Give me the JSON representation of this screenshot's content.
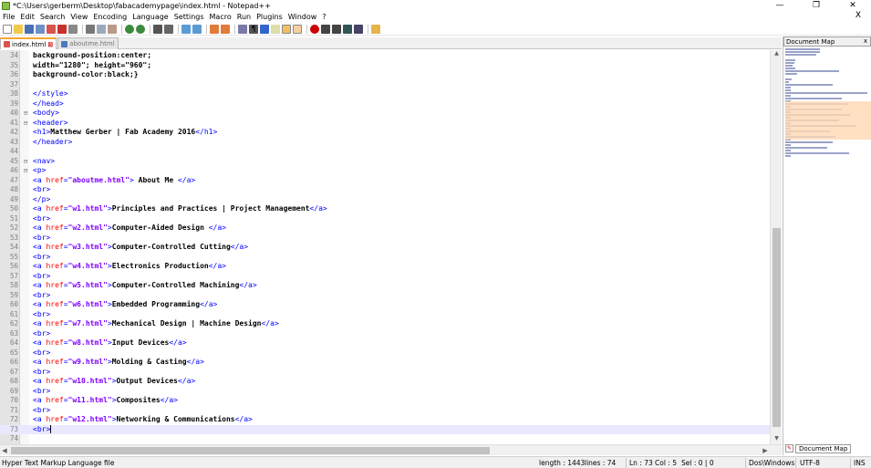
{
  "window": {
    "title": "*C:\\Users\\gerberm\\Desktop\\fabacademypage\\index.html - Notepad++",
    "minimize": "—",
    "maximize": "❐",
    "close": "✕"
  },
  "menu": [
    "File",
    "Edit",
    "Search",
    "View",
    "Encoding",
    "Language",
    "Settings",
    "Macro",
    "Run",
    "Plugins",
    "Window",
    "?"
  ],
  "menu_close_doc": "X",
  "tabs": [
    {
      "label": "index.html",
      "active": true,
      "modified": true
    },
    {
      "label": "aboutme.html",
      "active": false,
      "modified": false
    }
  ],
  "editor": {
    "lines": [
      {
        "n": "34",
        "fold": "",
        "segs": [
          {
            "c": "css",
            "t": "background-position:center;"
          }
        ]
      },
      {
        "n": "35",
        "fold": "",
        "segs": [
          {
            "c": "css",
            "t": "width=\"1280\"; height=\"960\";"
          }
        ]
      },
      {
        "n": "36",
        "fold": "",
        "segs": [
          {
            "c": "css",
            "t": "background-color:black;}"
          }
        ]
      },
      {
        "n": "37",
        "fold": "",
        "segs": []
      },
      {
        "n": "38",
        "fold": "",
        "segs": [
          {
            "c": "tag",
            "t": "</style>"
          }
        ]
      },
      {
        "n": "39",
        "fold": "",
        "segs": [
          {
            "c": "tag",
            "t": "</head>"
          }
        ]
      },
      {
        "n": "40",
        "fold": "⊟",
        "segs": [
          {
            "c": "tag",
            "t": "<body>"
          }
        ]
      },
      {
        "n": "41",
        "fold": "⊟",
        "segs": [
          {
            "c": "tag",
            "t": "<header>"
          }
        ]
      },
      {
        "n": "42",
        "fold": "",
        "segs": [
          {
            "c": "tag",
            "t": "<h1>"
          },
          {
            "c": "txt",
            "t": "Matthew Gerber | Fab Academy 2016"
          },
          {
            "c": "tag",
            "t": "</h1>"
          }
        ]
      },
      {
        "n": "43",
        "fold": "",
        "segs": [
          {
            "c": "tag",
            "t": "</header>"
          }
        ]
      },
      {
        "n": "44",
        "fold": "",
        "segs": []
      },
      {
        "n": "45",
        "fold": "⊟",
        "segs": [
          {
            "c": "tag",
            "t": "<nav>"
          }
        ]
      },
      {
        "n": "46",
        "fold": "⊟",
        "segs": [
          {
            "c": "tag",
            "t": "<p>"
          }
        ]
      },
      {
        "n": "47",
        "fold": "",
        "segs": [
          {
            "c": "tag",
            "t": "<a "
          },
          {
            "c": "attr",
            "t": "href"
          },
          {
            "c": "tag",
            "t": "="
          },
          {
            "c": "str",
            "t": "\"aboutme.html\""
          },
          {
            "c": "tag",
            "t": ">"
          },
          {
            "c": "txt",
            "t": " About Me "
          },
          {
            "c": "tag",
            "t": "</a>"
          }
        ]
      },
      {
        "n": "48",
        "fold": "",
        "segs": [
          {
            "c": "tag",
            "t": "<br>"
          }
        ]
      },
      {
        "n": "49",
        "fold": "",
        "segs": [
          {
            "c": "tag",
            "t": "</p>"
          }
        ]
      },
      {
        "n": "50",
        "fold": "",
        "segs": [
          {
            "c": "tag",
            "t": "<a "
          },
          {
            "c": "attr",
            "t": "href"
          },
          {
            "c": "tag",
            "t": "="
          },
          {
            "c": "str",
            "t": "\"w1.html\""
          },
          {
            "c": "tag",
            "t": ">"
          },
          {
            "c": "txt",
            "t": "Principles and Practices | Project Management"
          },
          {
            "c": "tag",
            "t": "</a>"
          }
        ]
      },
      {
        "n": "51",
        "fold": "",
        "segs": [
          {
            "c": "tag",
            "t": "<br>"
          }
        ]
      },
      {
        "n": "52",
        "fold": "",
        "segs": [
          {
            "c": "tag",
            "t": "<a "
          },
          {
            "c": "attr",
            "t": "href"
          },
          {
            "c": "tag",
            "t": "="
          },
          {
            "c": "str",
            "t": "\"w2.html\""
          },
          {
            "c": "tag",
            "t": ">"
          },
          {
            "c": "txt",
            "t": "Computer-Aided Design "
          },
          {
            "c": "tag",
            "t": "</a>"
          }
        ]
      },
      {
        "n": "53",
        "fold": "",
        "segs": [
          {
            "c": "tag",
            "t": "<br>"
          }
        ]
      },
      {
        "n": "54",
        "fold": "",
        "segs": [
          {
            "c": "tag",
            "t": "<a "
          },
          {
            "c": "attr",
            "t": "href"
          },
          {
            "c": "tag",
            "t": "="
          },
          {
            "c": "str",
            "t": "\"w3.html\""
          },
          {
            "c": "tag",
            "t": ">"
          },
          {
            "c": "txt",
            "t": "Computer-Controlled Cutting"
          },
          {
            "c": "tag",
            "t": "</a>"
          }
        ]
      },
      {
        "n": "55",
        "fold": "",
        "segs": [
          {
            "c": "tag",
            "t": "<br>"
          }
        ]
      },
      {
        "n": "56",
        "fold": "",
        "segs": [
          {
            "c": "tag",
            "t": "<a "
          },
          {
            "c": "attr",
            "t": "href"
          },
          {
            "c": "tag",
            "t": "="
          },
          {
            "c": "str",
            "t": "\"w4.html\""
          },
          {
            "c": "tag",
            "t": ">"
          },
          {
            "c": "txt",
            "t": "Electronics Production"
          },
          {
            "c": "tag",
            "t": "</a>"
          }
        ]
      },
      {
        "n": "57",
        "fold": "",
        "segs": [
          {
            "c": "tag",
            "t": "<br>"
          }
        ]
      },
      {
        "n": "58",
        "fold": "",
        "segs": [
          {
            "c": "tag",
            "t": "<a "
          },
          {
            "c": "attr",
            "t": "href"
          },
          {
            "c": "tag",
            "t": "="
          },
          {
            "c": "str",
            "t": "\"w5.html\""
          },
          {
            "c": "tag",
            "t": ">"
          },
          {
            "c": "txt",
            "t": "Computer-Controlled Machining"
          },
          {
            "c": "tag",
            "t": "</a>"
          }
        ]
      },
      {
        "n": "59",
        "fold": "",
        "segs": [
          {
            "c": "tag",
            "t": "<br>"
          }
        ]
      },
      {
        "n": "60",
        "fold": "",
        "segs": [
          {
            "c": "tag",
            "t": "<a "
          },
          {
            "c": "attr",
            "t": "href"
          },
          {
            "c": "tag",
            "t": "="
          },
          {
            "c": "str",
            "t": "\"w6.html\""
          },
          {
            "c": "tag",
            "t": ">"
          },
          {
            "c": "txt",
            "t": "Embedded Programming"
          },
          {
            "c": "tag",
            "t": "</a>"
          }
        ]
      },
      {
        "n": "61",
        "fold": "",
        "segs": [
          {
            "c": "tag",
            "t": "<br>"
          }
        ]
      },
      {
        "n": "62",
        "fold": "",
        "segs": [
          {
            "c": "tag",
            "t": "<a "
          },
          {
            "c": "attr",
            "t": "href"
          },
          {
            "c": "tag",
            "t": "="
          },
          {
            "c": "str",
            "t": "\"w7.html\""
          },
          {
            "c": "tag",
            "t": ">"
          },
          {
            "c": "txt",
            "t": "Mechanical Design | Machine Design"
          },
          {
            "c": "tag",
            "t": "</a>"
          }
        ]
      },
      {
        "n": "63",
        "fold": "",
        "segs": [
          {
            "c": "tag",
            "t": "<br>"
          }
        ]
      },
      {
        "n": "64",
        "fold": "",
        "segs": [
          {
            "c": "tag",
            "t": "<a "
          },
          {
            "c": "attr",
            "t": "href"
          },
          {
            "c": "tag",
            "t": "="
          },
          {
            "c": "str",
            "t": "\"w8.html\""
          },
          {
            "c": "tag",
            "t": ">"
          },
          {
            "c": "txt",
            "t": "Input Devices"
          },
          {
            "c": "tag",
            "t": "</a>"
          }
        ]
      },
      {
        "n": "65",
        "fold": "",
        "segs": [
          {
            "c": "tag",
            "t": "<br>"
          }
        ]
      },
      {
        "n": "66",
        "fold": "",
        "segs": [
          {
            "c": "tag",
            "t": "<a "
          },
          {
            "c": "attr",
            "t": "href"
          },
          {
            "c": "tag",
            "t": "="
          },
          {
            "c": "str",
            "t": "\"w9.html\""
          },
          {
            "c": "tag",
            "t": ">"
          },
          {
            "c": "txt",
            "t": "Molding & Casting"
          },
          {
            "c": "tag",
            "t": "</a>"
          }
        ]
      },
      {
        "n": "67",
        "fold": "",
        "segs": [
          {
            "c": "tag",
            "t": "<br>"
          }
        ]
      },
      {
        "n": "68",
        "fold": "",
        "segs": [
          {
            "c": "tag",
            "t": "<a "
          },
          {
            "c": "attr",
            "t": "href"
          },
          {
            "c": "tag",
            "t": "="
          },
          {
            "c": "str",
            "t": "\"w10.html\""
          },
          {
            "c": "tag",
            "t": ">"
          },
          {
            "c": "txt",
            "t": "Output Devices"
          },
          {
            "c": "tag",
            "t": "</a>"
          }
        ]
      },
      {
        "n": "69",
        "fold": "",
        "segs": [
          {
            "c": "tag",
            "t": "<br>"
          }
        ]
      },
      {
        "n": "70",
        "fold": "",
        "segs": [
          {
            "c": "tag",
            "t": "<a "
          },
          {
            "c": "attr",
            "t": "href"
          },
          {
            "c": "tag",
            "t": "="
          },
          {
            "c": "str",
            "t": "\"w11.html\""
          },
          {
            "c": "tag",
            "t": ">"
          },
          {
            "c": "txt",
            "t": "Composites"
          },
          {
            "c": "tag",
            "t": "</a>"
          }
        ]
      },
      {
        "n": "71",
        "fold": "",
        "segs": [
          {
            "c": "tag",
            "t": "<br>"
          }
        ]
      },
      {
        "n": "72",
        "fold": "",
        "segs": [
          {
            "c": "tag",
            "t": "<a "
          },
          {
            "c": "attr",
            "t": "href"
          },
          {
            "c": "tag",
            "t": "="
          },
          {
            "c": "str",
            "t": "\"w12.html\""
          },
          {
            "c": "tag",
            "t": ">"
          },
          {
            "c": "txt",
            "t": "Networking & Communications"
          },
          {
            "c": "tag",
            "t": "</a>"
          }
        ]
      },
      {
        "n": "73",
        "fold": "",
        "current": true,
        "segs": [
          {
            "c": "tag",
            "t": "<br>"
          }
        ]
      },
      {
        "n": "74",
        "fold": "",
        "segs": []
      }
    ]
  },
  "document_map": {
    "title": "Document Map",
    "close": "x",
    "bottom_tab": "Document Map"
  },
  "status": {
    "language": "Hyper Text Markup Language file",
    "length": "length : 1443",
    "lines": "lines : 74",
    "ln": "Ln : 73",
    "col": "Col : 5",
    "sel": "Sel : 0 | 0",
    "eol": "Dos\\Windows",
    "encoding": "UTF-8",
    "mode": "INS"
  },
  "colors": {
    "tag": "#0000ff",
    "attribute": "#ff0000",
    "string": "#8000ff",
    "active_tab_accent": "#f7a530",
    "current_line": "#e8e8ff"
  }
}
